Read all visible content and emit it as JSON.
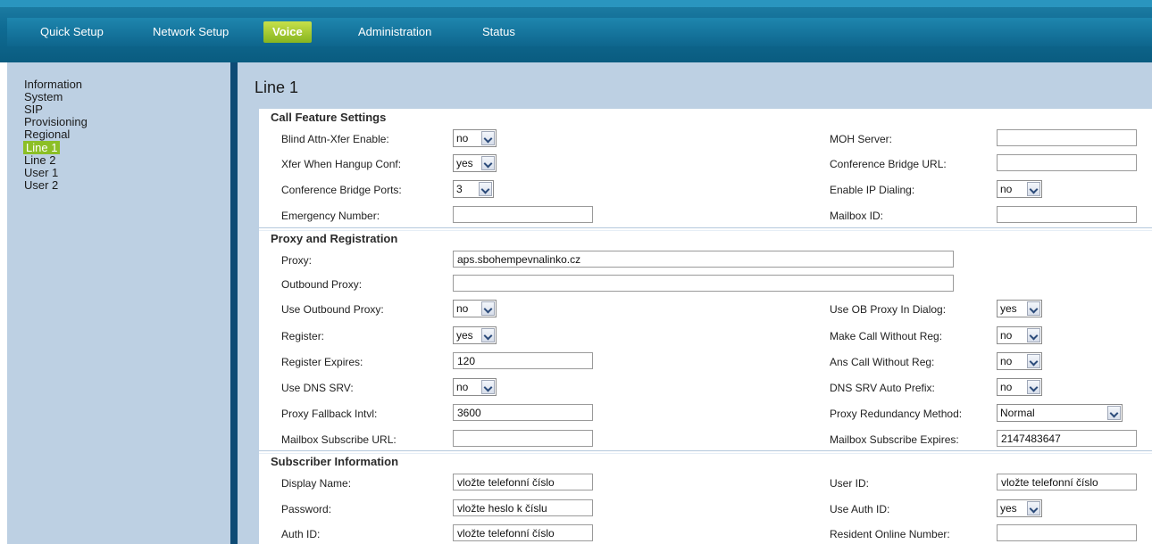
{
  "nav": {
    "items": [
      "Quick Setup",
      "Network Setup",
      "Voice",
      "Administration",
      "Status"
    ],
    "active": "Voice"
  },
  "sidebar": {
    "items": [
      "Information",
      "System",
      "SIP",
      "Provisioning",
      "Regional",
      "Line 1",
      "Line 2",
      "User 1",
      "User 2"
    ],
    "active": "Line 1"
  },
  "page": {
    "title": "Line 1"
  },
  "sections": {
    "call_feature": {
      "title": "Call Feature Settings",
      "blind_attn_xfer_enable": {
        "label": "Blind Attn-Xfer Enable:",
        "value": "no"
      },
      "xfer_when_hangup_conf": {
        "label": "Xfer When Hangup Conf:",
        "value": "yes"
      },
      "conference_bridge_ports": {
        "label": "Conference Bridge Ports:",
        "value": "3"
      },
      "emergency_number": {
        "label": "Emergency Number:",
        "value": ""
      },
      "moh_server": {
        "label": "MOH Server:",
        "value": ""
      },
      "conference_bridge_url": {
        "label": "Conference Bridge URL:",
        "value": ""
      },
      "enable_ip_dialing": {
        "label": "Enable IP Dialing:",
        "value": "no"
      },
      "mailbox_id": {
        "label": "Mailbox ID:",
        "value": ""
      }
    },
    "proxy_registration": {
      "title": "Proxy and Registration",
      "proxy": {
        "label": "Proxy:",
        "value": "aps.sbohempevnalinko.cz"
      },
      "outbound_proxy": {
        "label": "Outbound Proxy:",
        "value": ""
      },
      "use_outbound_proxy": {
        "label": "Use Outbound Proxy:",
        "value": "no"
      },
      "register": {
        "label": "Register:",
        "value": "yes"
      },
      "register_expires": {
        "label": "Register Expires:",
        "value": "120"
      },
      "use_dns_srv": {
        "label": "Use DNS SRV:",
        "value": "no"
      },
      "proxy_fallback_intvl": {
        "label": "Proxy Fallback Intvl:",
        "value": "3600"
      },
      "mailbox_subscribe_url": {
        "label": "Mailbox Subscribe URL:",
        "value": ""
      },
      "use_ob_proxy_in_dialog": {
        "label": "Use OB Proxy In Dialog:",
        "value": "yes"
      },
      "make_call_without_reg": {
        "label": "Make Call Without Reg:",
        "value": "no"
      },
      "ans_call_without_reg": {
        "label": "Ans Call Without Reg:",
        "value": "no"
      },
      "dns_srv_auto_prefix": {
        "label": "DNS SRV Auto Prefix:",
        "value": "no"
      },
      "proxy_redundancy_method": {
        "label": "Proxy Redundancy Method:",
        "value": "Normal"
      },
      "mailbox_subscribe_expires": {
        "label": "Mailbox Subscribe Expires:",
        "value": "2147483647"
      }
    },
    "subscriber": {
      "title": "Subscriber Information",
      "display_name": {
        "label": "Display Name:",
        "value": "vložte telefonní číslo"
      },
      "password": {
        "label": "Password:",
        "value": "vložte heslo k číslu"
      },
      "auth_id": {
        "label": "Auth ID:",
        "value": "vložte telefonní číslo"
      },
      "user_id": {
        "label": "User ID:",
        "value": "vložte telefonní číslo"
      },
      "use_auth_id": {
        "label": "Use Auth ID:",
        "value": "yes"
      },
      "resident_online_number": {
        "label": "Resident Online Number:",
        "value": ""
      }
    }
  }
}
